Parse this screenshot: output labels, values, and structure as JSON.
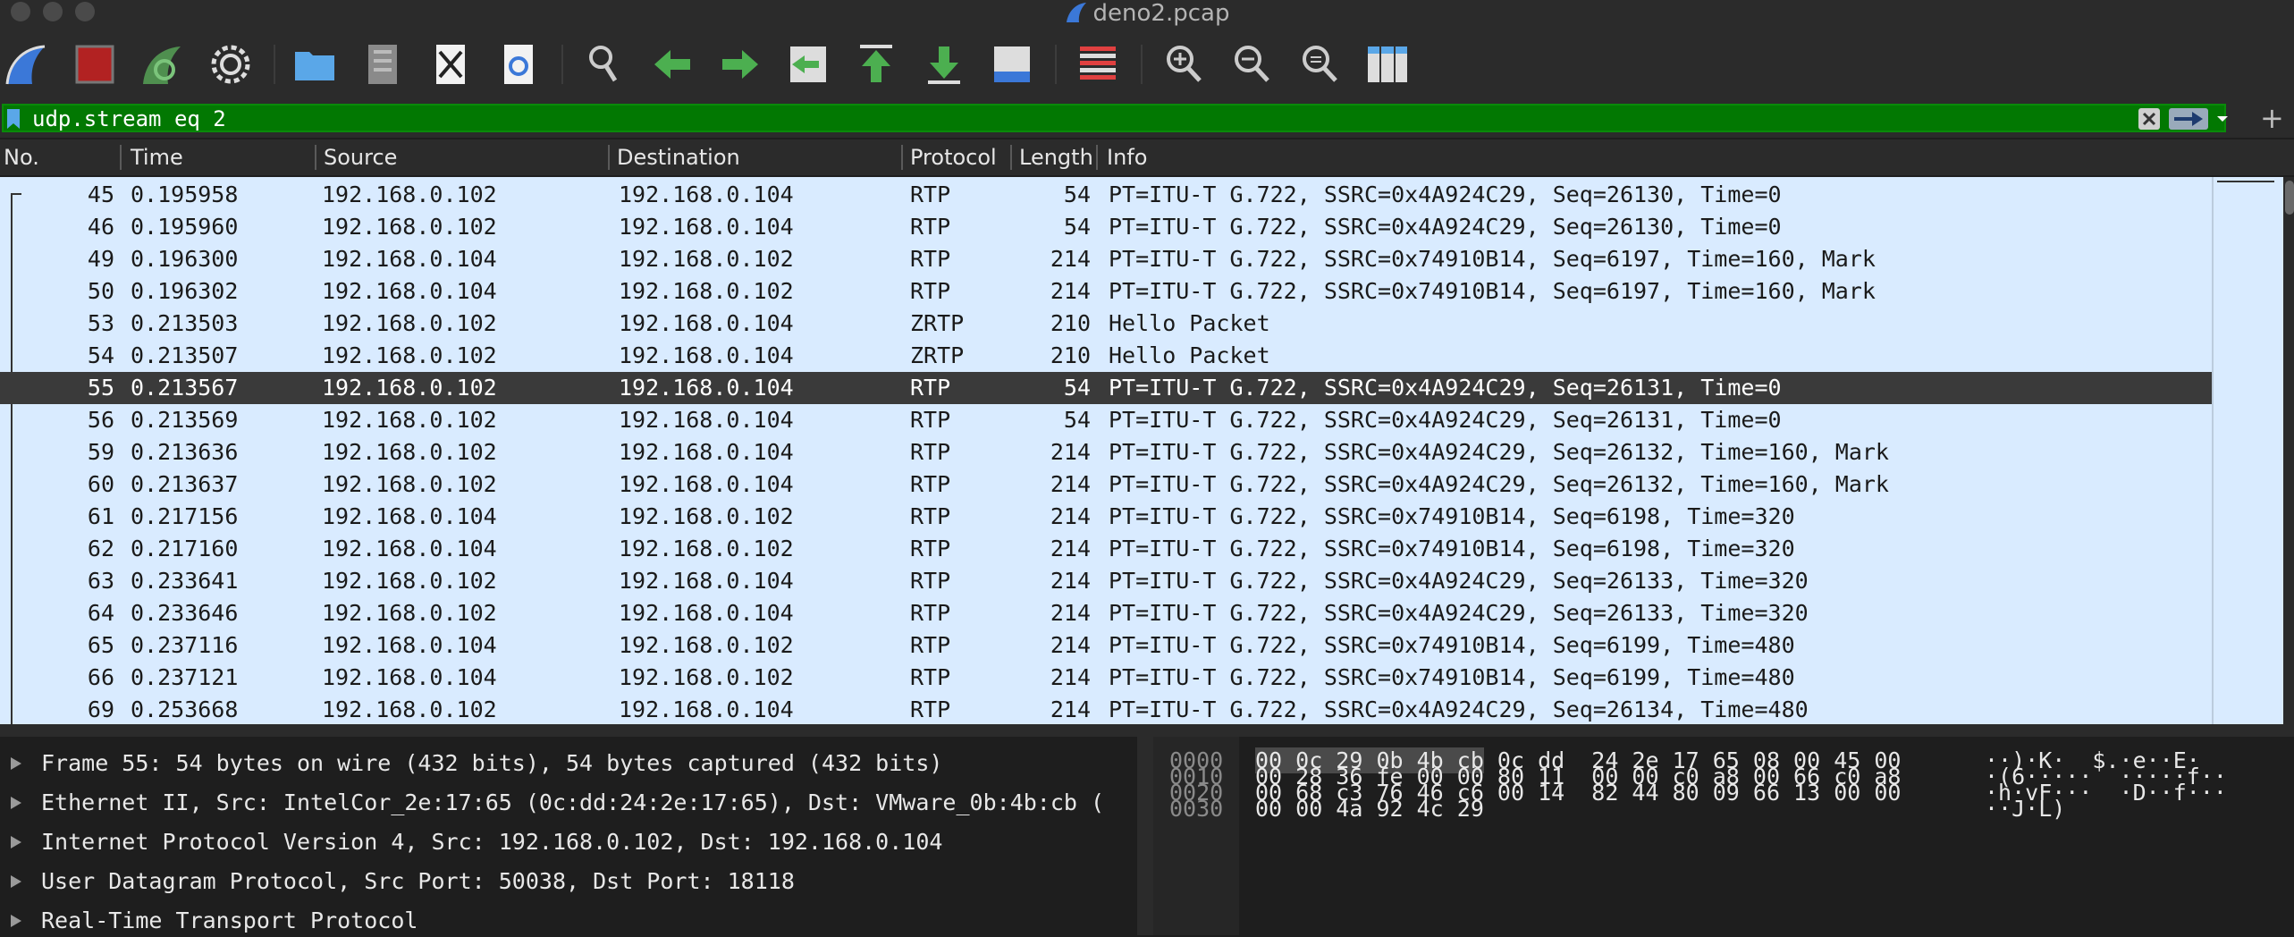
{
  "window": {
    "title": "deno2.pcap"
  },
  "toolbar": {
    "buttons": [
      {
        "name": "start-capture-icon",
        "color": "#3b78d8"
      },
      {
        "name": "stop-capture-icon",
        "color": "#b22222"
      },
      {
        "name": "restart-capture-icon",
        "color": "#4f8f4f"
      },
      {
        "name": "capture-options-icon",
        "color": "#dddddd"
      },
      {
        "name": "open-file-icon",
        "color": "#5aa7e8"
      },
      {
        "name": "save-file-icon",
        "color": "#8a8a8a"
      },
      {
        "name": "close-file-icon",
        "color": "#e6e6e6"
      },
      {
        "name": "reload-file-icon",
        "color": "#e6e6e6"
      },
      {
        "name": "find-packet-icon",
        "color": "#cccccc"
      },
      {
        "name": "go-back-icon",
        "color": "#4caf50"
      },
      {
        "name": "go-forward-icon",
        "color": "#4caf50"
      },
      {
        "name": "go-to-packet-icon",
        "color": "#4caf50"
      },
      {
        "name": "go-first-packet-icon",
        "color": "#4caf50"
      },
      {
        "name": "go-last-packet-icon",
        "color": "#4caf50"
      },
      {
        "name": "auto-scroll-icon",
        "color": "#dddddd"
      },
      {
        "name": "colorize-icon",
        "color": "#dddddd"
      },
      {
        "name": "zoom-in-icon",
        "color": "#cccccc"
      },
      {
        "name": "zoom-out-icon",
        "color": "#cccccc"
      },
      {
        "name": "normal-size-icon",
        "color": "#cccccc"
      },
      {
        "name": "resize-columns-icon",
        "color": "#5aa7e8"
      }
    ]
  },
  "filter": {
    "value": "udp.stream eq 2"
  },
  "columns": [
    "No.",
    "Time",
    "Source",
    "Destination",
    "Protocol",
    "Length",
    "Info"
  ],
  "packets": [
    {
      "no": "45",
      "time": "0.195958",
      "src": "192.168.0.102",
      "dst": "192.168.0.104",
      "proto": "RTP",
      "len": "54",
      "info": "PT=ITU-T G.722, SSRC=0x4A924C29, Seq=26130, Time=0"
    },
    {
      "no": "46",
      "time": "0.195960",
      "src": "192.168.0.102",
      "dst": "192.168.0.104",
      "proto": "RTP",
      "len": "54",
      "info": "PT=ITU-T G.722, SSRC=0x4A924C29, Seq=26130, Time=0"
    },
    {
      "no": "49",
      "time": "0.196300",
      "src": "192.168.0.104",
      "dst": "192.168.0.102",
      "proto": "RTP",
      "len": "214",
      "info": "PT=ITU-T G.722, SSRC=0x74910B14, Seq=6197, Time=160, Mark"
    },
    {
      "no": "50",
      "time": "0.196302",
      "src": "192.168.0.104",
      "dst": "192.168.0.102",
      "proto": "RTP",
      "len": "214",
      "info": "PT=ITU-T G.722, SSRC=0x74910B14, Seq=6197, Time=160, Mark"
    },
    {
      "no": "53",
      "time": "0.213503",
      "src": "192.168.0.102",
      "dst": "192.168.0.104",
      "proto": "ZRTP",
      "len": "210",
      "info": "Hello Packet"
    },
    {
      "no": "54",
      "time": "0.213507",
      "src": "192.168.0.102",
      "dst": "192.168.0.104",
      "proto": "ZRTP",
      "len": "210",
      "info": "Hello Packet"
    },
    {
      "no": "55",
      "time": "0.213567",
      "src": "192.168.0.102",
      "dst": "192.168.0.104",
      "proto": "RTP",
      "len": "54",
      "info": "PT=ITU-T G.722, SSRC=0x4A924C29, Seq=26131, Time=0"
    },
    {
      "no": "56",
      "time": "0.213569",
      "src": "192.168.0.102",
      "dst": "192.168.0.104",
      "proto": "RTP",
      "len": "54",
      "info": "PT=ITU-T G.722, SSRC=0x4A924C29, Seq=26131, Time=0"
    },
    {
      "no": "59",
      "time": "0.213636",
      "src": "192.168.0.102",
      "dst": "192.168.0.104",
      "proto": "RTP",
      "len": "214",
      "info": "PT=ITU-T G.722, SSRC=0x4A924C29, Seq=26132, Time=160, Mark"
    },
    {
      "no": "60",
      "time": "0.213637",
      "src": "192.168.0.102",
      "dst": "192.168.0.104",
      "proto": "RTP",
      "len": "214",
      "info": "PT=ITU-T G.722, SSRC=0x4A924C29, Seq=26132, Time=160, Mark"
    },
    {
      "no": "61",
      "time": "0.217156",
      "src": "192.168.0.104",
      "dst": "192.168.0.102",
      "proto": "RTP",
      "len": "214",
      "info": "PT=ITU-T G.722, SSRC=0x74910B14, Seq=6198, Time=320"
    },
    {
      "no": "62",
      "time": "0.217160",
      "src": "192.168.0.104",
      "dst": "192.168.0.102",
      "proto": "RTP",
      "len": "214",
      "info": "PT=ITU-T G.722, SSRC=0x74910B14, Seq=6198, Time=320"
    },
    {
      "no": "63",
      "time": "0.233641",
      "src": "192.168.0.102",
      "dst": "192.168.0.104",
      "proto": "RTP",
      "len": "214",
      "info": "PT=ITU-T G.722, SSRC=0x4A924C29, Seq=26133, Time=320"
    },
    {
      "no": "64",
      "time": "0.233646",
      "src": "192.168.0.102",
      "dst": "192.168.0.104",
      "proto": "RTP",
      "len": "214",
      "info": "PT=ITU-T G.722, SSRC=0x4A924C29, Seq=26133, Time=320"
    },
    {
      "no": "65",
      "time": "0.237116",
      "src": "192.168.0.104",
      "dst": "192.168.0.102",
      "proto": "RTP",
      "len": "214",
      "info": "PT=ITU-T G.722, SSRC=0x74910B14, Seq=6199, Time=480"
    },
    {
      "no": "66",
      "time": "0.237121",
      "src": "192.168.0.104",
      "dst": "192.168.0.102",
      "proto": "RTP",
      "len": "214",
      "info": "PT=ITU-T G.722, SSRC=0x74910B14, Seq=6199, Time=480"
    },
    {
      "no": "69",
      "time": "0.253668",
      "src": "192.168.0.102",
      "dst": "192.168.0.104",
      "proto": "RTP",
      "len": "214",
      "info": "PT=ITU-T G.722, SSRC=0x4A924C29, Seq=26134, Time=480"
    }
  ],
  "selected_packet_no": "55",
  "details": [
    "Frame 55: 54 bytes on wire (432 bits), 54 bytes captured (432 bits)",
    "Ethernet II, Src: IntelCor_2e:17:65 (0c:dd:24:2e:17:65), Dst: VMware_0b:4b:cb (",
    "Internet Protocol Version 4, Src: 192.168.0.102, Dst: 192.168.0.104",
    "User Datagram Protocol, Src Port: 50038, Dst Port: 18118",
    "Real-Time Transport Protocol"
  ],
  "hex": [
    {
      "offset": "0000",
      "highlight": "00 0c 29 0b 4b cb",
      "bytes": " 0c dd  24 2e 17 65 08 00 45 00",
      "ascii": "··)·K·  $.·e··E·"
    },
    {
      "offset": "0010",
      "highlight": "",
      "bytes": "00 28 36 fe 00 00 80 11  00 00 c0 a8 00 66 c0 a8",
      "ascii": "·(6·····  ·····f··"
    },
    {
      "offset": "0020",
      "highlight": "",
      "bytes": "00 68 c3 76 46 c6 00 14  82 44 80 09 66 13 00 00",
      "ascii": "·h·vF···  ·D··f···"
    },
    {
      "offset": "0030",
      "highlight": "",
      "bytes": "00 00 4a 92 4c 29",
      "ascii": "··J·L)"
    }
  ]
}
